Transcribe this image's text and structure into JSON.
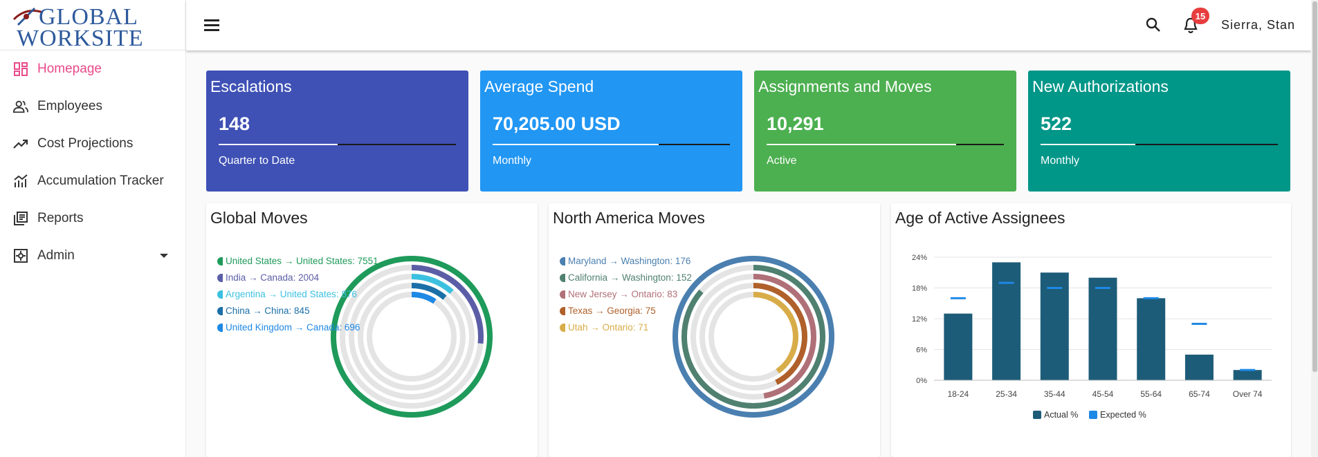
{
  "brand": {
    "logo_line1": "GLOBAL",
    "logo_line2": "WORKSITE"
  },
  "sidebar": {
    "items": [
      {
        "label": "Homepage",
        "icon": "dashboard-icon",
        "active": true
      },
      {
        "label": "Employees",
        "icon": "people-icon"
      },
      {
        "label": "Cost Projections",
        "icon": "trending-up-icon"
      },
      {
        "label": "Accumulation Tracker",
        "icon": "stacked-line-chart-icon"
      },
      {
        "label": "Reports",
        "icon": "library-books-icon"
      },
      {
        "label": "Admin",
        "icon": "admin-settings-icon",
        "has_dropdown": true
      }
    ]
  },
  "header": {
    "menu_icon": "hamburger-menu-icon",
    "search_icon": "search-icon",
    "bell_icon": "notifications-bell-icon",
    "notification_count": "15",
    "user_name": "Sierra, Stan"
  },
  "kpis": [
    {
      "title": "Escalations",
      "value": "148",
      "subtitle": "Quarter to Date",
      "color": "#3f51b5",
      "progress": 0.5
    },
    {
      "title": "Average Spend",
      "value": "70,205.00 USD",
      "subtitle": "Monthly",
      "color": "#2196f3",
      "progress": 0.7
    },
    {
      "title": "Assignments and Moves",
      "value": "10,291",
      "subtitle": "Active",
      "color": "#4caf50",
      "progress": 0.8
    },
    {
      "title": "New Authorizations",
      "value": "522",
      "subtitle": "Monthly",
      "color": "#009688",
      "progress": 0.4
    }
  ],
  "chart_data": [
    {
      "type": "radial-bar",
      "title": "Global Moves",
      "categories": [
        "United States → United States",
        "India → Canada",
        "Argentina → United States",
        "China → China",
        "United Kingdom → Canada"
      ],
      "values": [
        7551,
        2004,
        876,
        845,
        696
      ],
      "legend_labels": [
        "United States → United States: 7551",
        "India → Canada: 2004",
        "Argentina → United States: 876",
        "China → China: 845",
        "United Kingdom → Canada: 696"
      ],
      "colors": [
        "#1e9a5a",
        "#5b5ea6",
        "#3cc0e0",
        "#1a6fa8",
        "#1e88e5"
      ],
      "max": 7551
    },
    {
      "type": "radial-bar",
      "title": "North America Moves",
      "categories": [
        "Maryland → Washington",
        "California → Washington",
        "New Jersey → Ontario",
        "Texas → Georgia",
        "Utah → Ontario"
      ],
      "values": [
        176,
        152,
        83,
        75,
        71
      ],
      "legend_labels": [
        "Maryland → Washington: 176",
        "California → Washington: 152",
        "New Jersey → Ontario: 83",
        "Texas → Georgia: 75",
        "Utah → Ontario: 71"
      ],
      "colors": [
        "#4a7fb0",
        "#4f8070",
        "#b07078",
        "#b0602a",
        "#d8ac48"
      ],
      "max": 176
    },
    {
      "type": "bar",
      "title": "Age of Active Assignees",
      "categories": [
        "18-24",
        "25-34",
        "35-44",
        "45-54",
        "55-64",
        "65-74",
        "Over 74"
      ],
      "series": [
        {
          "name": "Actual %",
          "values": [
            13,
            23,
            21,
            20,
            16,
            5,
            2
          ],
          "color": "#1d5c78"
        },
        {
          "name": "Expected %",
          "values": [
            16,
            19,
            18,
            18,
            16,
            11,
            2
          ],
          "color": "#1e88e5"
        }
      ],
      "ytick_labels": [
        "0%",
        "6%",
        "12%",
        "18%",
        "24%"
      ],
      "yticks": [
        0,
        6,
        12,
        18,
        24
      ],
      "ylim": [
        0,
        24
      ],
      "grid": true,
      "legend": "bottom"
    }
  ]
}
